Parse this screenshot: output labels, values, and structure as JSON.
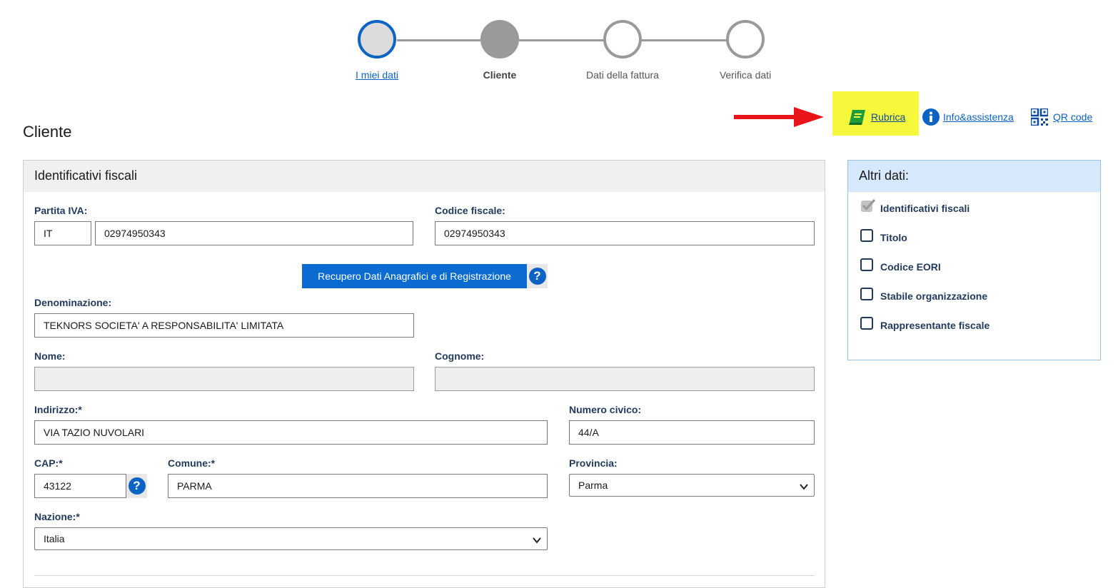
{
  "stepper": {
    "steps": [
      {
        "label": "I miei dati",
        "state": "visited"
      },
      {
        "label": "Cliente",
        "state": "current"
      },
      {
        "label": "Dati della fattura",
        "state": "todo"
      },
      {
        "label": "Verifica dati",
        "state": "todo"
      }
    ]
  },
  "toplinks": {
    "rubrica": "Rubrica",
    "info": "Info&assistenza",
    "qr": "QR code"
  },
  "colors": {
    "accent": "#0b63c4",
    "highlight": "#f6f93b",
    "arrow": "#e8141a",
    "book": "#1e9b3c"
  },
  "page": {
    "title": "Cliente"
  },
  "panel": {
    "title": "Identificativi fiscali",
    "partita_iva": {
      "label": "Partita IVA:",
      "country": "IT",
      "value": "02974950343"
    },
    "codice_fiscale": {
      "label": "Codice fiscale:",
      "value": "02974950343"
    },
    "recupero_button": "Recupero Dati Anagrafici e di Registrazione",
    "help_icon": "?",
    "denominazione": {
      "label": "Denominazione:",
      "value": "TEKNORS SOCIETA' A RESPONSABILITA' LIMITATA"
    },
    "nome": {
      "label": "Nome:",
      "value": ""
    },
    "cognome": {
      "label": "Cognome:",
      "value": ""
    },
    "indirizzo": {
      "label": "Indirizzo:*",
      "value": "VIA TAZIO NUVOLARI"
    },
    "numero_civico": {
      "label": "Numero civico:",
      "value": "44/A"
    },
    "cap": {
      "label": "CAP:*",
      "value": "43122"
    },
    "comune": {
      "label": "Comune:*",
      "value": "PARMA"
    },
    "provincia": {
      "label": "Provincia:",
      "value": "Parma"
    },
    "nazione": {
      "label": "Nazione:*",
      "value": "Italia"
    }
  },
  "side": {
    "title": "Altri dati:",
    "items": [
      {
        "label": "Identificativi fiscali",
        "checked": true
      },
      {
        "label": "Titolo",
        "checked": false
      },
      {
        "label": "Codice EORI",
        "checked": false
      },
      {
        "label": "Stabile organizzazione",
        "checked": false
      },
      {
        "label": "Rappresentante fiscale",
        "checked": false
      }
    ]
  }
}
